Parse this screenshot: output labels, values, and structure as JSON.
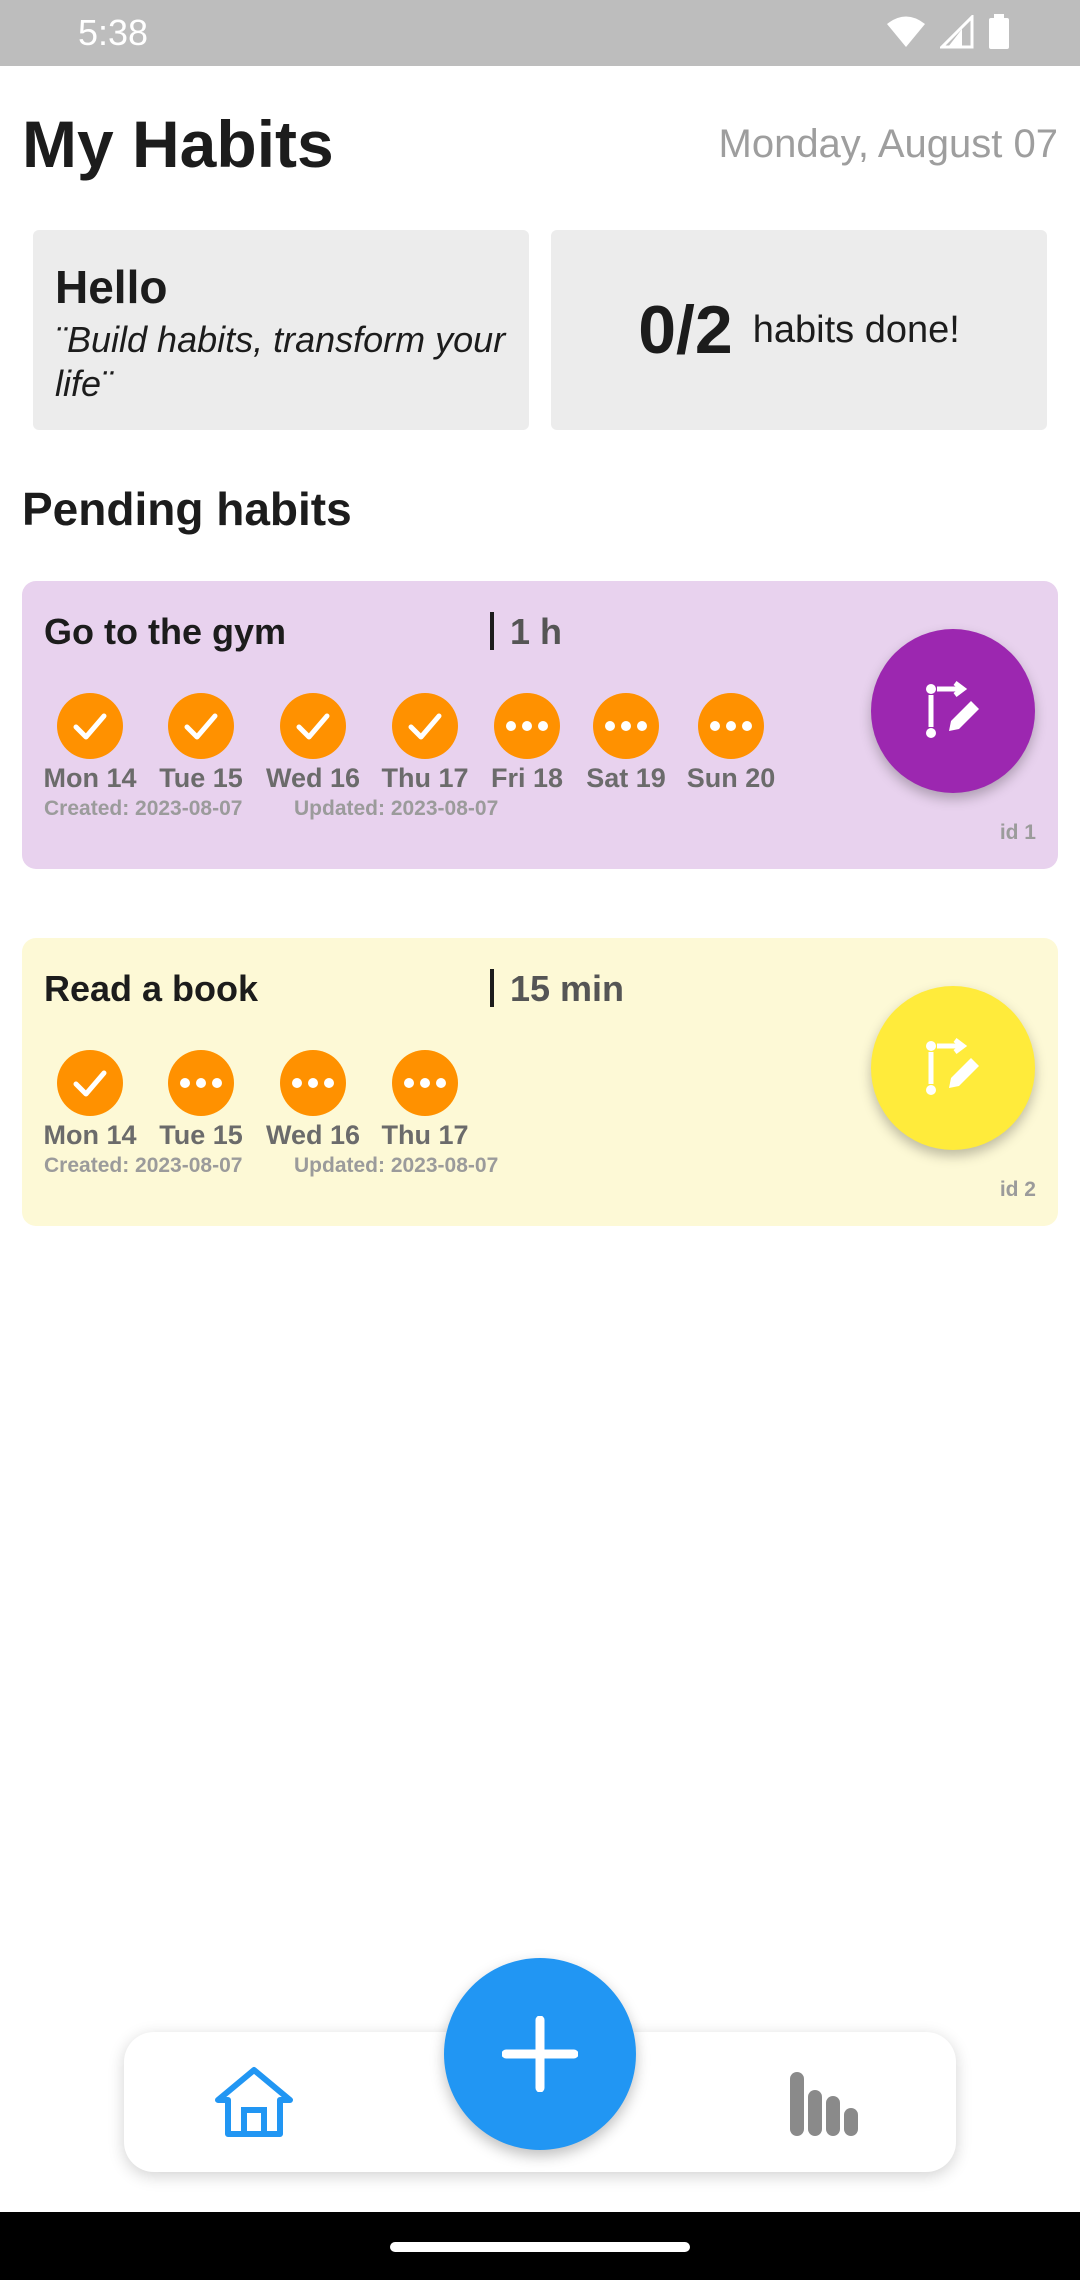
{
  "status_bar": {
    "time": "5:38"
  },
  "header": {
    "title": "My Habits",
    "date": "Monday, August 07"
  },
  "hello_card": {
    "title": "Hello",
    "quote": "¨Build habits, transform your life¨"
  },
  "progress_card": {
    "count": "0/2",
    "label": "habits done!"
  },
  "section_title": "Pending habits",
  "habits": [
    {
      "name": "Go to the gym",
      "duration": "1 h",
      "color": "#e8d2ee",
      "fab_color": "#9c27b0",
      "days": [
        {
          "label": "Mon 14",
          "status": "done"
        },
        {
          "label": "Tue 15",
          "status": "done"
        },
        {
          "label": "Wed 16",
          "status": "done"
        },
        {
          "label": "Thu 17",
          "status": "done"
        },
        {
          "label": "Fri 18",
          "status": "pending"
        },
        {
          "label": "Sat 19",
          "status": "pending"
        },
        {
          "label": "Sun 20",
          "status": "pending"
        }
      ],
      "created": "Created: 2023-08-07",
      "updated": "Updated: 2023-08-07",
      "id": "id 1"
    },
    {
      "name": "Read a book",
      "duration": "15 min",
      "color": "#fdf9d6",
      "fab_color": "#ffeb3b",
      "days": [
        {
          "label": "Mon 14",
          "status": "done"
        },
        {
          "label": "Tue 15",
          "status": "pending"
        },
        {
          "label": "Wed 16",
          "status": "pending"
        },
        {
          "label": "Thu 17",
          "status": "pending"
        }
      ],
      "created": "Created: 2023-08-07",
      "updated": "Updated: 2023-08-07",
      "id": "id 2"
    }
  ],
  "icons": {
    "done": "check-icon",
    "pending": "more-horizontal-icon",
    "edit": "edit-habit-icon",
    "home": "home-icon",
    "stats": "bar-chart-icon",
    "add": "plus-icon"
  },
  "colors": {
    "accent": "#2196f3",
    "day_circle": "#ff9100"
  }
}
